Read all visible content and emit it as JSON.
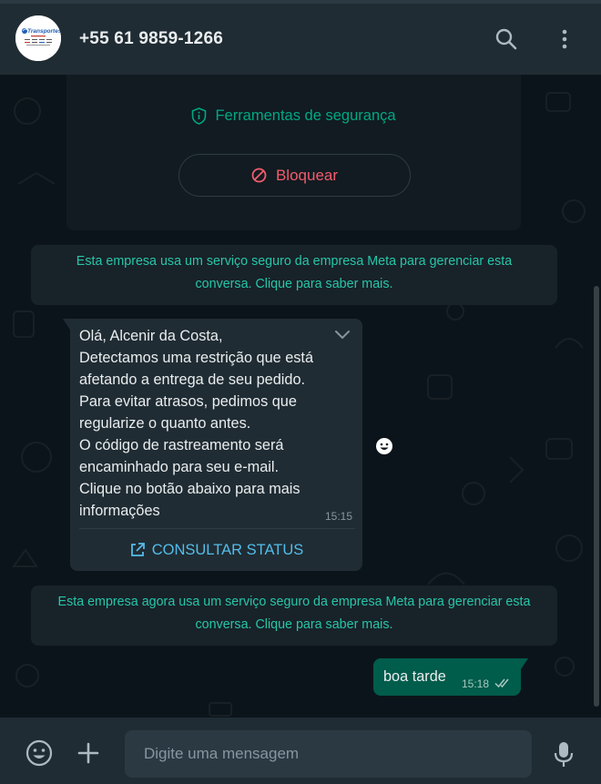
{
  "header": {
    "contact_name": "+55 61 9859-1266",
    "avatar_icon": "company-logo",
    "search_icon": "search-icon",
    "menu_icon": "menu-dots-icon"
  },
  "profile_card": {
    "security_tools_label": "Ferramentas de segurança",
    "block_label": "Bloquear"
  },
  "system_messages": [
    "Esta empresa usa um serviço seguro da empresa Meta para gerenciar esta conversa. Clique para saber mais.",
    "Esta empresa agora usa um serviço seguro da empresa Meta para gerenciar esta conversa. Clique para saber mais."
  ],
  "incoming_message": {
    "text": "Olá, Alcenir da Costa,\nDetectamos uma restrição que está afetando a entrega de seu pedido.\nPara evitar atrasos, pedimos que regularize o quanto antes.\nO código de rastreamento será encaminhado para seu e-mail.\nClique no botão abaixo para mais informações",
    "time": "15:15",
    "button_label": "CONSULTAR STATUS"
  },
  "outgoing_message": {
    "text": "boa tarde",
    "time": "15:18",
    "status": "read"
  },
  "composer": {
    "placeholder": "Digite uma mensagem"
  },
  "colors": {
    "accent": "#00a884",
    "danger": "#f15c6d",
    "link": "#53bdeb",
    "outgoing_bubble": "#005c4b",
    "incoming_bubble": "#202c33",
    "background": "#0b141a"
  }
}
